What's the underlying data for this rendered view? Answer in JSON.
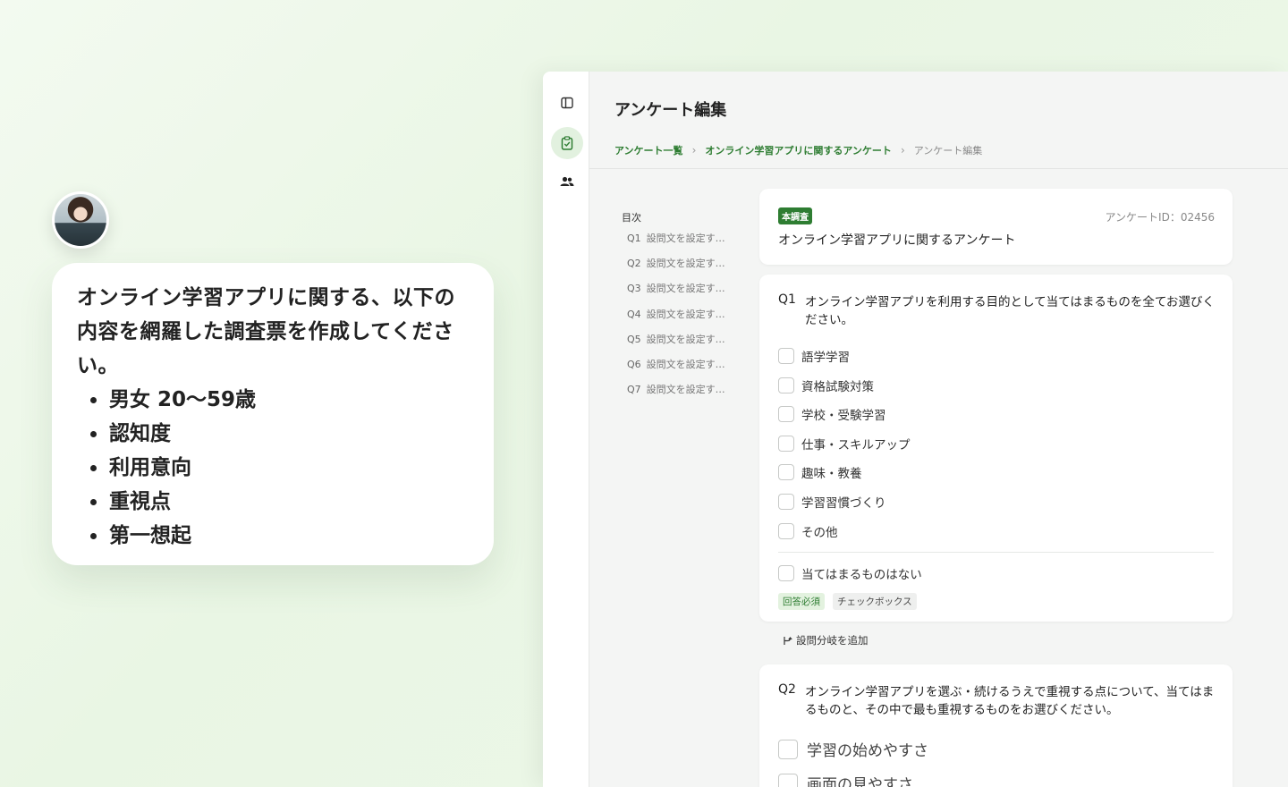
{
  "chat": {
    "message": "オンライン学習アプリに関する、以下の内容を網羅した調査票を作成してください。",
    "bullets": [
      "男女 20〜59歳",
      "認知度",
      "利用意向",
      "重視点",
      "第一想起"
    ]
  },
  "header": {
    "title": "アンケート編集",
    "breadcrumb": [
      "アンケート一覧",
      "オンライン学習アプリに関するアンケート",
      "アンケート編集"
    ]
  },
  "toc": {
    "title": "目次",
    "items": [
      {
        "num": "Q1",
        "label": "設問文を設定す…"
      },
      {
        "num": "Q2",
        "label": "設問文を設定す…"
      },
      {
        "num": "Q3",
        "label": "設問文を設定す…"
      },
      {
        "num": "Q4",
        "label": "設問文を設定す…"
      },
      {
        "num": "Q5",
        "label": "設問文を設定す…"
      },
      {
        "num": "Q6",
        "label": "設問文を設定す…"
      },
      {
        "num": "Q7",
        "label": "設問文を設定す…"
      }
    ]
  },
  "survey": {
    "badge": "本調査",
    "id_label": "アンケートID：02456",
    "name": "オンライン学習アプリに関するアンケート"
  },
  "q1": {
    "num": "Q1",
    "text": "オンライン学習アプリを利用する目的として当てはまるものを全てお選びください。",
    "options": [
      "語学学習",
      "資格試験対策",
      "学校・受験学習",
      "仕事・スキルアップ",
      "趣味・教養",
      "学習習慣づくり",
      "その他"
    ],
    "exclusive_option": "当てはまるものはない",
    "tags": {
      "required": "回答必須",
      "type": "チェックボックス"
    }
  },
  "branch": {
    "label": "設問分岐を追加"
  },
  "q2": {
    "num": "Q2",
    "text": "オンライン学習アプリを選ぶ・続けるうえで重視する点について、当てはまるものと、その中で最も重視するものをお選びください。",
    "options": [
      "学習の始めやすさ",
      "画面の見やすさ"
    ]
  },
  "colors": {
    "accent": "#2e7d32",
    "accent_light": "#e3f2df",
    "background": "#eef8ea"
  },
  "icons": {
    "sidebar_toggle": "panel-icon",
    "survey": "clipboard-check-icon",
    "users": "users-icon",
    "branch": "branch-icon"
  }
}
